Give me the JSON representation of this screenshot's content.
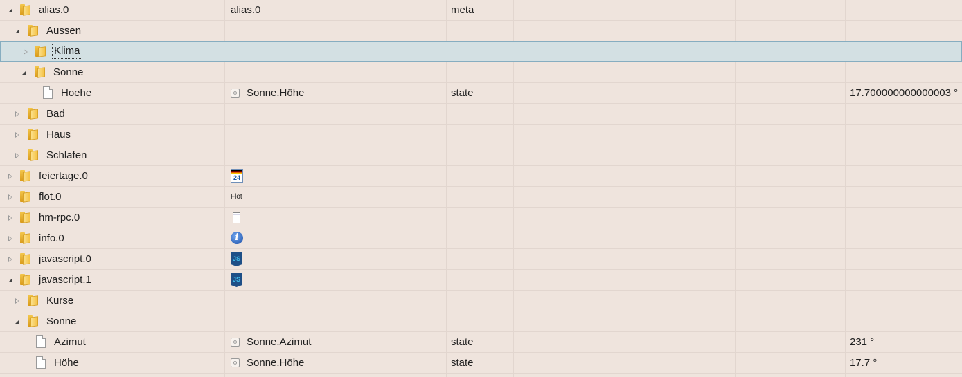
{
  "rows": [
    {
      "name": "alias.0",
      "col2": "alias.0",
      "type": "meta",
      "value": ""
    },
    {
      "name": "Aussen",
      "col2": "",
      "type": "",
      "value": ""
    },
    {
      "name": "Klima",
      "col2": "",
      "type": "",
      "value": ""
    },
    {
      "name": "Sonne",
      "col2": "",
      "type": "",
      "value": ""
    },
    {
      "name": "Hoehe",
      "col2": "Sonne.Höhe",
      "type": "state",
      "value": "17.700000000000003 °"
    },
    {
      "name": "Bad",
      "col2": "",
      "type": "",
      "value": ""
    },
    {
      "name": "Haus",
      "col2": "",
      "type": "",
      "value": ""
    },
    {
      "name": "Schlafen",
      "col2": "",
      "type": "",
      "value": ""
    },
    {
      "name": "feiertage.0",
      "col2": "",
      "type": "",
      "value": ""
    },
    {
      "name": "flot.0",
      "col2": "",
      "type": "",
      "value": ""
    },
    {
      "name": "hm-rpc.0",
      "col2": "",
      "type": "",
      "value": ""
    },
    {
      "name": "info.0",
      "col2": "",
      "type": "",
      "value": ""
    },
    {
      "name": "javascript.0",
      "col2": "",
      "type": "",
      "value": ""
    },
    {
      "name": "javascript.1",
      "col2": "",
      "type": "",
      "value": ""
    },
    {
      "name": "Kurse",
      "col2": "",
      "type": "",
      "value": ""
    },
    {
      "name": "Sonne",
      "col2": "",
      "type": "",
      "value": ""
    },
    {
      "name": "Azimut",
      "col2": "Sonne.Azimut",
      "type": "state",
      "value": "231 °"
    },
    {
      "name": "Höhe",
      "col2": "Sonne.Höhe",
      "type": "state",
      "value": "17.7 °"
    }
  ],
  "icons": {
    "feiertage_day": "24",
    "flot_text": "Flot",
    "info_glyph": "i",
    "js_text": "JS"
  }
}
